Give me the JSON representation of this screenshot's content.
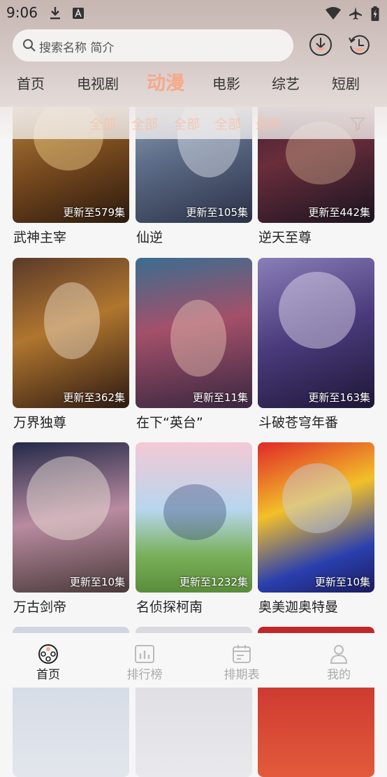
{
  "status_bar": {
    "time": "9:06"
  },
  "search": {
    "placeholder": "搜索名称 简介"
  },
  "tabs": [
    {
      "label": "首页"
    },
    {
      "label": "电视剧"
    },
    {
      "label": "动漫",
      "active": true
    },
    {
      "label": "电影"
    },
    {
      "label": "综艺"
    },
    {
      "label": "短剧"
    }
  ],
  "filters": [
    "全部",
    "全部",
    "全部",
    "全部",
    "最新"
  ],
  "cards": [
    {
      "title": "武神主宰",
      "badge": "更新至579集"
    },
    {
      "title": "仙逆",
      "badge": "更新至105集"
    },
    {
      "title": "逆天至尊",
      "badge": "更新至442集"
    },
    {
      "title": "万界独尊",
      "badge": "更新至362集"
    },
    {
      "title": "在下“英台”",
      "badge": "更新至11集"
    },
    {
      "title": "斗破苍穹年番",
      "badge": "更新至163集"
    },
    {
      "title": "万古剑帝",
      "badge": "更新至10集"
    },
    {
      "title": "名侦探柯南",
      "badge": "更新至1232集"
    },
    {
      "title": "奥美迦奥特曼",
      "badge": "更新至10集"
    }
  ],
  "bottom_nav": [
    {
      "label": "首页",
      "icon": "film-reel-icon",
      "active": true
    },
    {
      "label": "排行榜",
      "icon": "chart-icon"
    },
    {
      "label": "排期表",
      "icon": "calendar-icon"
    },
    {
      "label": "我的",
      "icon": "user-icon"
    }
  ],
  "colors": {
    "accent": "#f5a98a",
    "header_bg": "#c7b6b2",
    "nav_inactive": "#aaaaaa"
  }
}
